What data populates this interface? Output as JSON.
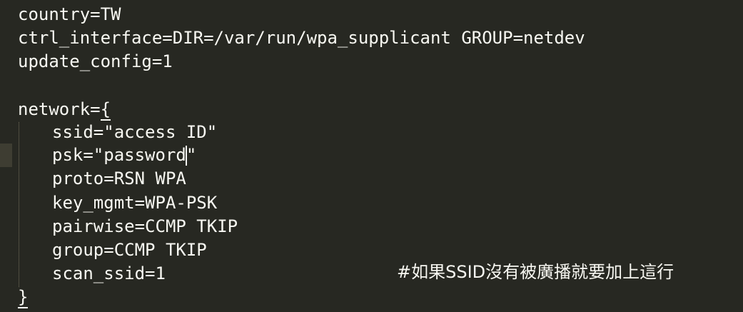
{
  "editor": {
    "lines": {
      "country": "country=TW",
      "ctrl_interface": "ctrl_interface=DIR=/var/run/wpa_supplicant GROUP=netdev",
      "update_config": "update_config=1",
      "network_open_prefix": "network=",
      "network_open_brace": "{",
      "ssid": "ssid=\"access ID\"",
      "psk_before_cursor": "psk=\"password",
      "psk_after_cursor": "\"",
      "proto": "proto=RSN WPA",
      "key_mgmt": "key_mgmt=WPA-PSK",
      "pairwise": "pairwise=CCMP TKIP",
      "group": "group=CCMP TKIP",
      "scan_ssid": "scan_ssid=1",
      "close_brace": "}"
    },
    "comment": "#如果SSID沒有被廣播就要加上這行"
  }
}
